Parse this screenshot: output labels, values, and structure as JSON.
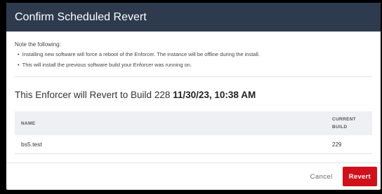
{
  "dialog": {
    "title": "Confirm Scheduled Revert"
  },
  "notes": {
    "title": "Note the following:",
    "items": [
      "Installing new software will force a reboot of the Enforcer. The instance will be offline during the install.",
      "This will install the previous software build your Enforcer was running on."
    ],
    "bullet": "•"
  },
  "revert": {
    "prefix": "This Enforcer will Revert to Build 228",
    "datetime": "11/30/23, 10:38 AM"
  },
  "table": {
    "columns": {
      "name": "NAME",
      "current_build_line1": "CURRENT",
      "current_build_line2": "BUILD"
    },
    "rows": [
      {
        "name": "bs5.test",
        "current_build": "229"
      }
    ]
  },
  "footer": {
    "cancel_label": "Cancel",
    "revert_label": "Revert"
  },
  "colors": {
    "header_bg": "#2e3b4e",
    "revert_button": "#d0111b",
    "table_header_bg": "#eef0f3"
  }
}
